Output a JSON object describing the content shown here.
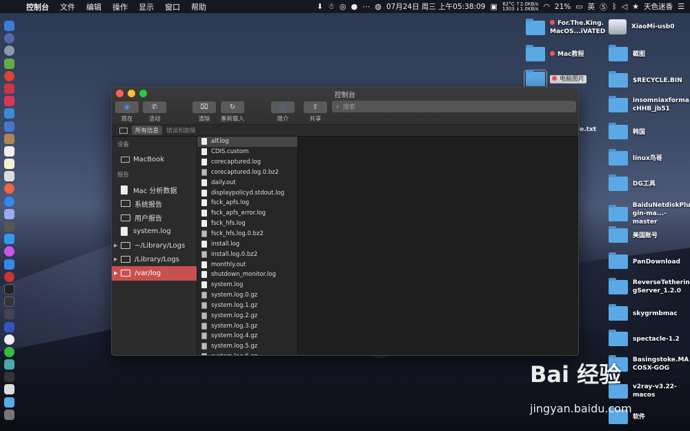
{
  "menubar": {
    "apple": "",
    "app": "控制台",
    "items": [
      "文件",
      "编辑",
      "操作",
      "显示",
      "窗口",
      "帮助"
    ],
    "temp": "62°C",
    "fan": "1303",
    "net_up": "↑2.0KB/s",
    "net_down": "↓1.0KB/s",
    "datetime": "07月24日 周三 上午05:38:09",
    "battery": "21%",
    "ime": "英",
    "user": "天色迷香"
  },
  "desktop": {
    "icons": [
      {
        "label": "For.The.King.\nMacOS...iVATED",
        "tag": true
      },
      {
        "label": "Mac教程",
        "tag": true
      },
      {
        "label": "电脑图片",
        "tag": true,
        "selected": true
      },
      {
        "label": "XiaoMi-usb0"
      },
      {
        "label": "截图"
      },
      {
        "label": "$RECYCLE.BIN"
      },
      {
        "label": "insomniaxforma\ncHHB_jb51"
      },
      {
        "label": "韩国"
      },
      {
        "label": "linux鸟哥"
      },
      {
        "label": "DG工具"
      },
      {
        "label": "BaiduNetdiskPlu\ngin-ma...-master"
      },
      {
        "label": "美国账号"
      },
      {
        "label": "PanDownload"
      },
      {
        "label": "ReverseTetherin\ngServer_1.2.0"
      },
      {
        "label": "skygrmbmac"
      },
      {
        "label": "spectacle-1.2"
      },
      {
        "label": "Basingstoke.MA\nCOSX-GOG"
      },
      {
        "label": "v2ray-v3.22-\nmacos"
      },
      {
        "label": "软件"
      }
    ],
    "partial_text": "le.txt"
  },
  "window": {
    "title": "控制台",
    "toolbar": {
      "now": "现在",
      "activity": "活动",
      "clear": "清除",
      "reload": "重新载入",
      "info": "简介",
      "share": "共享",
      "search_placeholder": "搜索"
    },
    "filter": {
      "all": "所有信息",
      "errors": "错误和故障"
    },
    "sidebar": {
      "devices_header": "设备",
      "device": "MacBook",
      "reports_header": "报告",
      "items": [
        "Mac 分析数据",
        "系统报告",
        "用户报告",
        "system.log",
        "~/Library/Logs",
        "/Library/Logs",
        "/var/log"
      ]
    },
    "files": [
      "alf.log",
      "CDIS.custom",
      "corecaptured.log",
      "corecaptured.log.0.bz2",
      "daily.out",
      "displaypolicyd.stdout.log",
      "fsck_apfs.log",
      "fsck_apfs_error.log",
      "fsck_hfs.log",
      "fsck_hfs.log.0.bz2",
      "install.log",
      "install.log.0.bz2",
      "monthly.out",
      "shutdown_monitor.log",
      "system.log",
      "system.log.0.gz",
      "system.log.1.gz",
      "system.log.2.gz",
      "system.log.3.gz",
      "system.log.4.gz",
      "system.log.5.gz",
      "system.log.6.gz"
    ]
  },
  "watermark": {
    "logo": "Bai 经验",
    "url": "jingyan.baidu.com"
  }
}
